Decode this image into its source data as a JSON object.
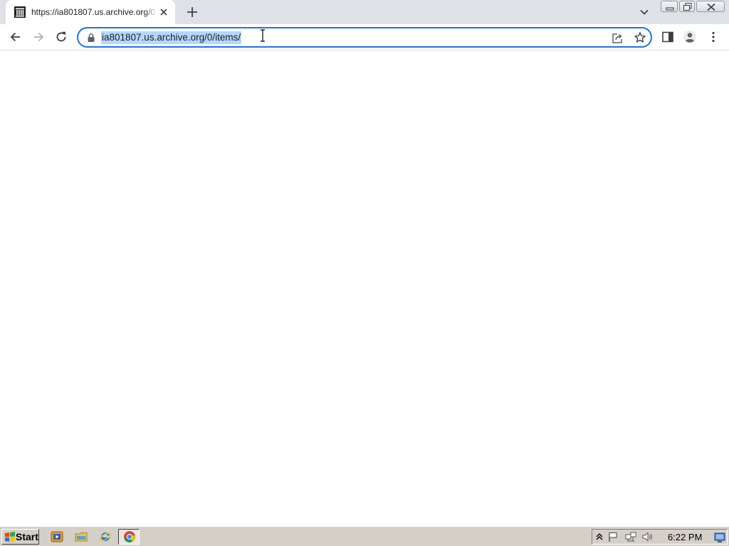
{
  "browser": {
    "tab": {
      "title": "https://ia801807.us.archive.org/0/items/",
      "favicon": "archive-org-icon"
    },
    "url": "ia801807.us.archive.org/0/items/",
    "accent_color": "#1a73e8",
    "selection_color": "#b3d7fd"
  },
  "icons": {
    "tab_close": "close-icon",
    "new_tab": "plus-icon",
    "tab_search": "chevron-down-icon",
    "back": "back-arrow-icon",
    "forward": "forward-arrow-icon",
    "reload": "reload-icon",
    "lock": "lock-icon",
    "share": "share-icon",
    "bookmark": "star-icon",
    "side_panel": "side-panel-icon",
    "profile": "profile-icon",
    "menu": "more-vertical-icon"
  },
  "taskbar": {
    "start_label": "Start",
    "quick_launch": [
      "media-player-icon",
      "folder-icon",
      "internet-explorer-icon",
      "chrome-icon"
    ],
    "tray_icons": [
      "show-hidden-icon",
      "flag-icon",
      "network-icon",
      "volume-icon"
    ],
    "clock": "6:22 PM",
    "color": "#d4d0c8"
  }
}
